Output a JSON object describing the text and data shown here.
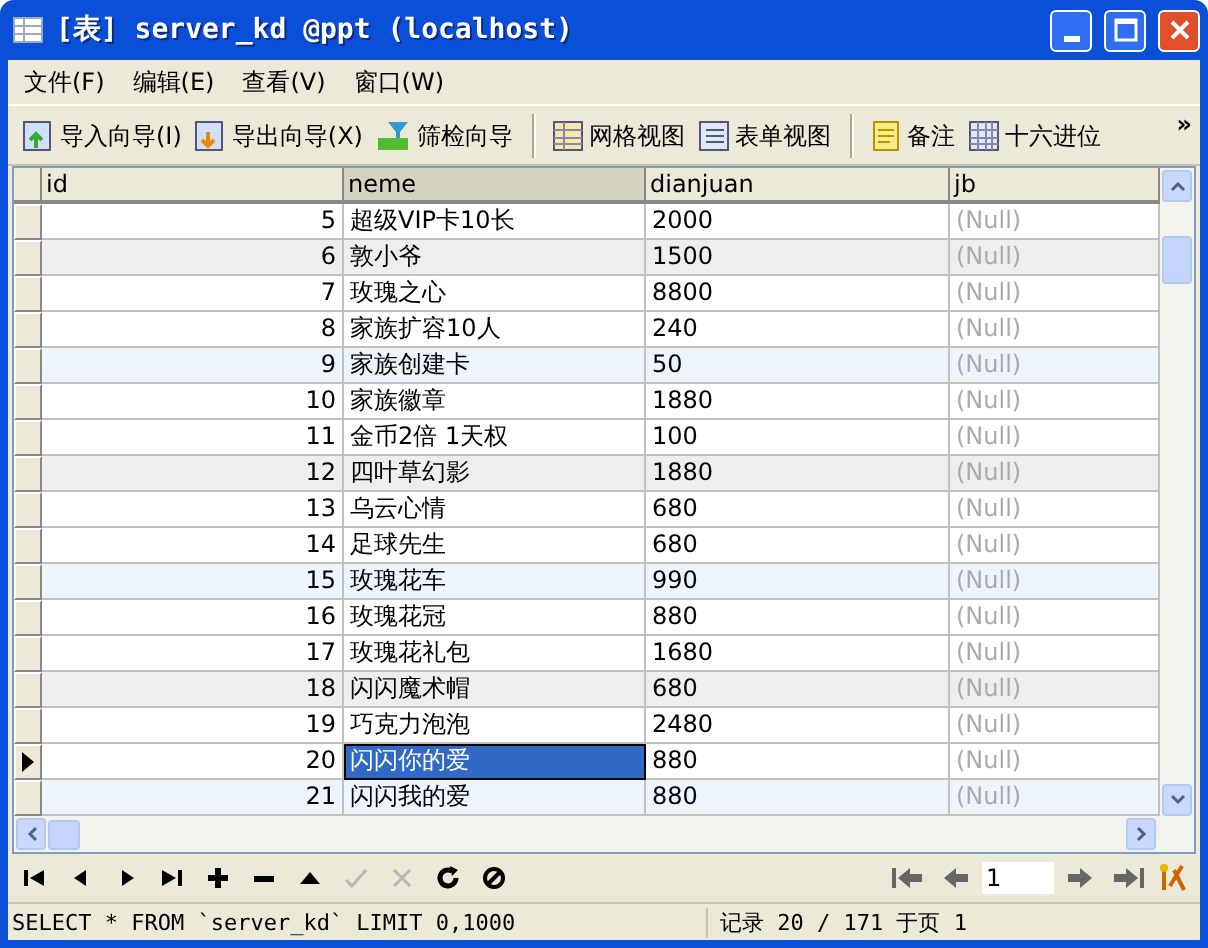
{
  "window": {
    "title": "[表] server_kd @ppt (localhost)"
  },
  "menu": [
    "文件(F)",
    "编辑(E)",
    "查看(V)",
    "窗口(W)"
  ],
  "toolbar": {
    "groups": [
      [
        {
          "label": "导入向导(I)",
          "kind": "import"
        },
        {
          "label": "导出向导(X)",
          "kind": "export"
        },
        {
          "label": "筛检向导",
          "kind": "filter"
        }
      ],
      [
        {
          "label": "网格视图",
          "kind": "grid"
        },
        {
          "label": "表单视图",
          "kind": "form"
        }
      ],
      [
        {
          "label": "备注",
          "kind": "memo"
        },
        {
          "label": "十六进位",
          "kind": "hex"
        }
      ]
    ],
    "overflow": "»"
  },
  "table": {
    "columns": [
      {
        "label": "id",
        "kind": "number",
        "focused": false
      },
      {
        "label": "neme",
        "kind": "text",
        "focused": true
      },
      {
        "label": "dianjuan",
        "kind": "text",
        "focused": false
      },
      {
        "label": "jb",
        "kind": "null",
        "focused": false
      }
    ],
    "rows": [
      {
        "cells": [
          "5",
          "超级VIP卡10长",
          "2000",
          "(Null)"
        ],
        "color": "#ffffff",
        "selected": false
      },
      {
        "cells": [
          "6",
          "敦小爷",
          "1500",
          "(Null)"
        ],
        "color": "#eeeeee",
        "selected": false
      },
      {
        "cells": [
          "7",
          "玫瑰之心",
          "8800",
          "(Null)"
        ],
        "color": "#ffffff",
        "selected": false
      },
      {
        "cells": [
          "8",
          "家族扩容10人",
          "240",
          "(Null)"
        ],
        "color": "#ffffff",
        "selected": false
      },
      {
        "cells": [
          "9",
          "家族创建卡",
          "50",
          "(Null)"
        ],
        "color": "#eef4fc",
        "selected": false
      },
      {
        "cells": [
          "10",
          "家族徽章",
          "1880",
          "(Null)"
        ],
        "color": "#ffffff",
        "selected": false
      },
      {
        "cells": [
          "11",
          "金币2倍 1天权",
          "100",
          "(Null)"
        ],
        "color": "#ffffff",
        "selected": false
      },
      {
        "cells": [
          "12",
          "四叶草幻影",
          "1880",
          "(Null)"
        ],
        "color": "#eeeeee",
        "selected": false
      },
      {
        "cells": [
          "13",
          "乌云心情",
          "680",
          "(Null)"
        ],
        "color": "#ffffff",
        "selected": false
      },
      {
        "cells": [
          "14",
          "足球先生",
          "680",
          "(Null)"
        ],
        "color": "#ffffff",
        "selected": false
      },
      {
        "cells": [
          "15",
          "玫瑰花车",
          "990",
          "(Null)"
        ],
        "color": "#eef4fc",
        "selected": false
      },
      {
        "cells": [
          "16",
          "玫瑰花冠",
          "880",
          "(Null)"
        ],
        "color": "#ffffff",
        "selected": false
      },
      {
        "cells": [
          "17",
          "玫瑰花礼包",
          "1680",
          "(Null)"
        ],
        "color": "#ffffff",
        "selected": false
      },
      {
        "cells": [
          "18",
          "闪闪魔术帽",
          "680",
          "(Null)"
        ],
        "color": "#eeeeee",
        "selected": false
      },
      {
        "cells": [
          "19",
          "巧克力泡泡",
          "2480",
          "(Null)"
        ],
        "color": "#ffffff",
        "selected": false
      },
      {
        "cells": [
          "20",
          "闪闪你的爱",
          "880",
          "(Null)"
        ],
        "color": "#ffffff",
        "selected": true
      },
      {
        "cells": [
          "21",
          "闪闪我的爱",
          "880",
          "(Null)"
        ],
        "color": "#eef4fc",
        "selected": false
      }
    ]
  },
  "navigator": {
    "buttons": [
      {
        "kind": "first",
        "disabled": false
      },
      {
        "kind": "prev",
        "disabled": false
      },
      {
        "kind": "next",
        "disabled": false
      },
      {
        "kind": "last",
        "disabled": false
      },
      {
        "kind": "add",
        "disabled": false
      },
      {
        "kind": "delete",
        "disabled": false
      },
      {
        "kind": "up",
        "disabled": false
      },
      {
        "kind": "apply",
        "disabled": true
      },
      {
        "kind": "cancel",
        "disabled": true
      },
      {
        "kind": "refresh",
        "disabled": false
      },
      {
        "kind": "stop",
        "disabled": false
      }
    ],
    "page": "1"
  },
  "status_bar": {
    "query": "SELECT * FROM `server_kd` LIMIT 0,1000",
    "record": "记录 20 / 171 于页 1"
  }
}
